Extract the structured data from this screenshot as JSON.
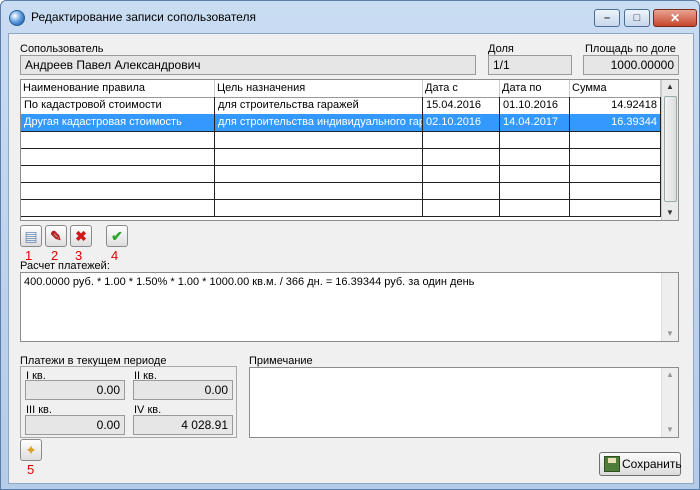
{
  "window": {
    "title": "Редактирование записи сопользователя",
    "min_glyph": "–",
    "max_glyph": "□",
    "close_glyph": "✕"
  },
  "owner": {
    "label": "Сопользователь",
    "value": "Андреев Павел Александрович"
  },
  "share": {
    "label": "Доля",
    "value": "1/1"
  },
  "area": {
    "label": "Площадь по доле",
    "value": "1000.00000"
  },
  "grid": {
    "columns": [
      "Наименование правила",
      "Цель назначения",
      "Дата с",
      "Дата по",
      "Сумма"
    ],
    "rows": [
      {
        "rule": "По кадастровой стоимости",
        "purpose": "для строительства гаражей",
        "from": "15.04.2016",
        "to": "01.10.2016",
        "sum": "14.92418",
        "selected": false
      },
      {
        "rule": "Другая кадастровая стоимость",
        "purpose": "для строительства индивидуального гаража",
        "from": "02.10.2016",
        "to": "14.04.2017",
        "sum": "16.39344",
        "selected": true
      }
    ],
    "empty_rows": 5,
    "scroll_up": "▲",
    "scroll_down": "▼"
  },
  "toolbar": {
    "add_icon": "document-add-icon",
    "edit_icon": "pencil-icon",
    "delete_icon": "delete-x-icon",
    "confirm_icon": "checkmark-icon",
    "add_glyph": "▤",
    "edit_glyph": "✎",
    "delete_glyph": "✖",
    "confirm_glyph": "✔",
    "markers": [
      "1",
      "2",
      "3",
      "4"
    ]
  },
  "calc": {
    "label": "Расчет платежей:",
    "text": "400.0000 руб. * 1.00 * 1.50% * 1.00 * 1000.00 кв.м. / 366 дн. = 16.39344 руб. за один день"
  },
  "payments": {
    "label": "Платежи в текущем периоде",
    "q1_label": "I кв.",
    "q1_value": "0.00",
    "q2_label": "II кв.",
    "q2_value": "0.00",
    "q3_label": "III кв.",
    "q3_value": "0.00",
    "q4_label": "IV кв.",
    "q4_value": "4 028.91"
  },
  "note": {
    "label": "Примечание",
    "value": ""
  },
  "bottom": {
    "new_icon": "new-document-icon",
    "new_glyph": "✦",
    "marker": "5",
    "save_label": "Сохранить"
  },
  "colors": {
    "selection": "#3399ff",
    "marker": "#e00000",
    "confirm": "#2aa52a",
    "delete": "#d01818"
  }
}
